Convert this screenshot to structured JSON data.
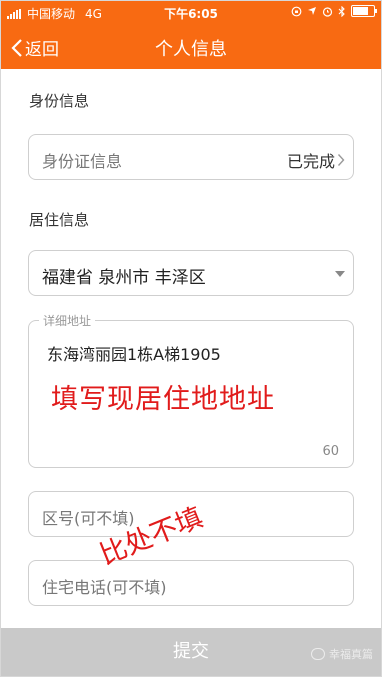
{
  "status_bar": {
    "carrier": "中国移动",
    "network": "4G",
    "time": "下午6:05",
    "battery_level": 0.85
  },
  "nav": {
    "back_label": "返回",
    "title": "个人信息"
  },
  "identity_section": {
    "title": "身份信息",
    "field_label": "身份证信息",
    "status": "已完成"
  },
  "residence_section": {
    "title": "居住信息",
    "region": "福建省 泉州市 丰泽区",
    "address_legend": "详细地址",
    "address_value": "东海湾丽园1栋A梯1905",
    "address_annotation": "填写现居住地地址",
    "char_count": "60",
    "area_code_placeholder": "区号(可不填)",
    "phone_placeholder": "住宅电话(可不填)",
    "skip_annotation": "比处不填"
  },
  "footer": {
    "submit_label": "提交",
    "watermark": "幸福真篇"
  },
  "colors": {
    "accent": "#f86a12",
    "annotation": "#e11b1b",
    "submit_disabled": "#c9c9c9"
  }
}
